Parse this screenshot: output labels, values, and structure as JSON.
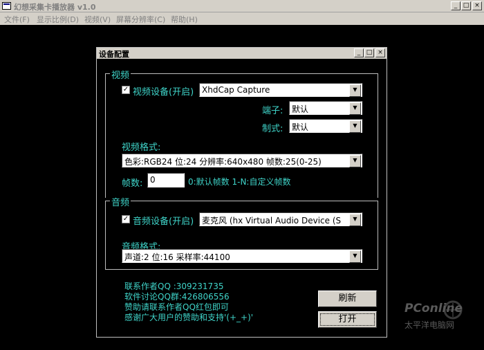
{
  "app": {
    "title": "幻想采集卡播放器 v1.0",
    "caption_buttons": [
      "_",
      "□",
      "×"
    ]
  },
  "menu": [
    "文件(F)",
    "显示比例(D)",
    "视频(V)",
    "屏幕分辨率(C)",
    "帮助(H)"
  ],
  "dialog": {
    "title": "设备配置",
    "caption_buttons": [
      "_",
      "□",
      "×"
    ],
    "video": {
      "group_label": "视频",
      "checkbox_label": "视频设备(开启)",
      "checked": true,
      "device": "XhdCap Capture",
      "port_label": "端子:",
      "port_value": "默认",
      "standard_label": "制式:",
      "standard_value": "默认",
      "format_label": "视频格式:",
      "format_value": "色彩:RGB24 位:24 分辨率:640x480 帧数:25(0-25)",
      "fps_label": "帧数:",
      "fps_value": "0",
      "fps_hint": "0:默认帧数  1-N:自定义帧数"
    },
    "audio": {
      "group_label": "音频",
      "checkbox_label": "音频设备(开启)",
      "checked": true,
      "device": "麦克风 (hx Virtual Audio Device (S",
      "format_label": "音频格式:",
      "format_value": "声道:2 位:16 采样率:44100"
    },
    "info_lines": [
      "联系作者QQ  :309231735",
      "软件讨论QQ群:426806556",
      "赞助请联系作者QQ红包即可",
      "感谢广大用户的赞助和支持'(+_+)'"
    ],
    "refresh_button": "刷新",
    "open_button": "打开"
  },
  "watermark": {
    "brand": "PConline",
    "subtitle": "太平洋电脑网"
  }
}
